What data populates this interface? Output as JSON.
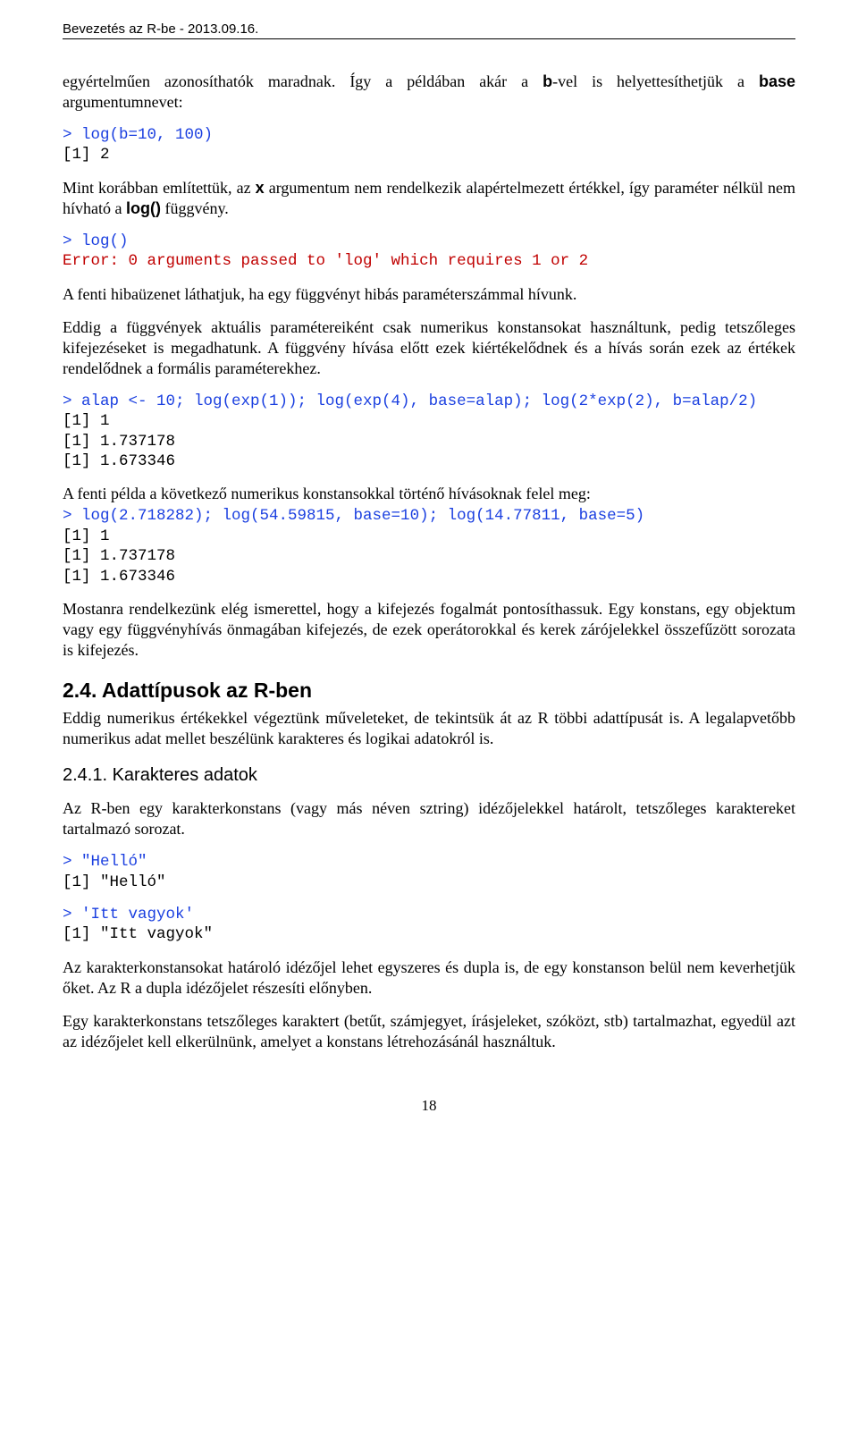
{
  "header": "Bevezetés az R-be - 2013.09.16.",
  "p1_a": "egyértelműen azonosíthatók maradnak. Így a példában akár a ",
  "p1_bold1": "b",
  "p1_b": "-vel is helyettesíthetjük a ",
  "p1_bold2": "base",
  "p1_c": " argumentumnevet:",
  "code1_prompt": "> log(b=10, 100)",
  "code1_out": "[1] 2",
  "p2_a": "Mint korábban említettük, az ",
  "p2_bold1": "x",
  "p2_b": " argumentum nem rendelkezik alapértelmezett értékkel, így paraméter nélkül nem hívható a ",
  "p2_bold2": "log()",
  "p2_c": " függvény.",
  "code2_prompt": "> log()",
  "code2_err": "Error: 0 arguments passed to 'log' which requires 1 or 2",
  "p3": "A fenti hibaüzenet láthatjuk, ha egy függvényt hibás paraméterszámmal hívunk.",
  "p4": "Eddig a függvények aktuális paramétereiként csak numerikus konstansokat használtunk, pedig tetszőleges kifejezéseket is megadhatunk. A függvény hívása előtt ezek kiértékelődnek és a hívás során ezek az értékek rendelődnek a formális paraméterekhez.",
  "code3_prompt": "> alap <- 10; log(exp(1)); log(exp(4), base=alap); log(2*exp(2), b=alap/2)",
  "code3_out1": "[1] 1",
  "code3_out2": "[1] 1.737178",
  "code3_out3": "[1] 1.673346",
  "p5": "A fenti példa a következő numerikus konstansokkal történő hívásoknak felel meg:",
  "code4_prompt": "> log(2.718282); log(54.59815, base=10); log(14.77811, base=5)",
  "code4_out1": "[1] 1",
  "code4_out2": "[1] 1.737178",
  "code4_out3": "[1] 1.673346",
  "p6": "Mostanra rendelkezünk elég ismerettel, hogy a kifejezés fogalmát pontosíthassuk. Egy konstans, egy objektum vagy egy függvényhívás önmagában kifejezés, de ezek operátorokkal és kerek zárójelekkel összefűzött sorozata is kifejezés.",
  "h2": "2.4. Adattípusok az R-ben",
  "p7": "Eddig numerikus értékekkel végeztünk műveleteket, de tekintsük át az R többi adattípusát is. A legalapvetőbb numerikus adat mellet beszélünk karakteres és logikai adatokról is.",
  "h3": "2.4.1. Karakteres adatok",
  "p8": "Az R-ben egy karakterkonstans (vagy más néven sztring) idézőjelekkel határolt, tetszőleges karaktereket tartalmazó sorozat.",
  "code5_prompt": "> \"Helló\"",
  "code5_out": "[1] \"Helló\"",
  "code6_prompt": "> 'Itt vagyok'",
  "code6_out": "[1] \"Itt vagyok\"",
  "p9": "Az karakterkonstansokat határoló idézőjel lehet egyszeres és dupla is, de egy konstanson belül nem keverhetjük őket. Az R a dupla idézőjelet részesíti előnyben.",
  "p10": "Egy karakterkonstans tetszőleges karaktert (betűt, számjegyet, írásjeleket, szóközt, stb) tartalmazhat, egyedül azt az idézőjelet kell elkerülnünk, amelyet a konstans létrehozásánál használtuk.",
  "pagenum": "18"
}
